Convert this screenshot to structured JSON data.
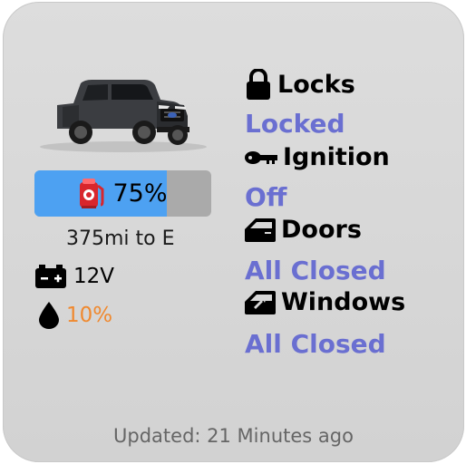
{
  "fuel": {
    "level_pct": 75,
    "label": "75%",
    "range_text": "375mi to E",
    "fill_color": "#4da1f2",
    "icon": "fuel-pump-icon"
  },
  "battery": {
    "label": "12V",
    "icon": "battery-icon"
  },
  "oil": {
    "label": "10%",
    "color": "#f0892f",
    "icon": "oil-drop-icon"
  },
  "status": {
    "locks": {
      "label": "Locks",
      "value": "Locked",
      "icon": "lock-icon"
    },
    "ignition": {
      "label": "Ignition",
      "value": "Off",
      "icon": "key-icon"
    },
    "doors": {
      "label": "Doors",
      "value": "All Closed",
      "icon": "door-icon"
    },
    "windows": {
      "label": "Windows",
      "value": "All Closed",
      "icon": "window-icon"
    }
  },
  "accent_color": "#6a6fd1",
  "footer": {
    "updated": "Updated: 21 Minutes ago"
  }
}
